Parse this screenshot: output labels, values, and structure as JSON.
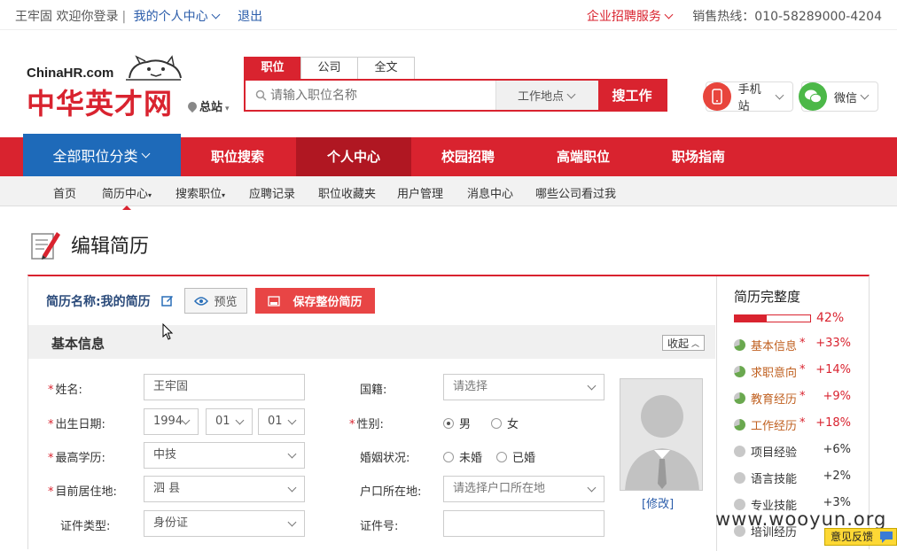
{
  "topbar": {
    "greeting": "王牢固 欢迎你登录",
    "separator": "|",
    "personal_center": "我的个人中心",
    "logout": "退出",
    "enterprise_service": "企业招聘服务",
    "hotline": "销售热线：010-58289000-4204"
  },
  "logo": {
    "en": "ChinaHR.com",
    "cn": "中华英才网"
  },
  "station": "总站",
  "search": {
    "tabs": [
      "职位",
      "公司",
      "全文"
    ],
    "placeholder": "请输入职位名称",
    "location": "工作地点",
    "button": "搜工作"
  },
  "apps": {
    "mobile": "手机站",
    "wechat": "微信"
  },
  "mainnav": {
    "all": "全部职位分类",
    "items": [
      "职位搜索",
      "个人中心",
      "校园招聘",
      "高端职位",
      "职场指南"
    ]
  },
  "subnav": [
    "首页",
    "简历中心",
    "搜索职位",
    "应聘记录",
    "职位收藏夹",
    "用户管理",
    "消息中心",
    "哪些公司看过我"
  ],
  "page_title": "编辑简历",
  "resume": {
    "name_label": "简历名称:我的简历",
    "preview": "预览",
    "save": "保存整份简历"
  },
  "section": {
    "title": "基本信息",
    "collapse": "收起"
  },
  "form": {
    "name_label": "姓名:",
    "name_value": "王牢固",
    "birth_label": "出生日期:",
    "birth_year": "1994",
    "birth_month": "01",
    "birth_day": "01",
    "edu_label": "最高学历:",
    "edu_value": "中技",
    "residence_label": "目前居住地:",
    "residence_value": "泗  县",
    "id_type_label": "证件类型:",
    "id_type_value": "身份证",
    "nationality_label": "国籍:",
    "nationality_value": "请选择",
    "gender_label": "性别:",
    "gender_male": "男",
    "gender_female": "女",
    "marital_label": "婚姻状况:",
    "marital_single": "未婚",
    "marital_married": "已婚",
    "hukou_label": "户口所在地:",
    "hukou_value": "请选择户口所在地",
    "id_no_label": "证件号:",
    "id_no_value": "",
    "photo_modify": "[修改]"
  },
  "completeness": {
    "title": "简历完整度",
    "percent": "42%",
    "fraction": 0.42,
    "items": [
      {
        "name": "基本信息",
        "star": "*",
        "value": "+33%",
        "done": true
      },
      {
        "name": "求职意向",
        "star": "*",
        "value": "+14%",
        "done": true
      },
      {
        "name": "教育经历",
        "star": "*",
        "value": "+9%",
        "done": true
      },
      {
        "name": "工作经历",
        "star": "*",
        "value": "+18%",
        "done": true
      },
      {
        "name": "项目经验",
        "star": "",
        "value": "+6%",
        "done": false
      },
      {
        "name": "语言技能",
        "star": "",
        "value": "+2%",
        "done": false
      },
      {
        "name": "专业技能",
        "star": "",
        "value": "+3%",
        "done": false
      },
      {
        "name": "培训经历",
        "star": "",
        "value": "",
        "done": false
      }
    ]
  },
  "watermark": "www.wooyun.org",
  "feedback": "意见反馈",
  "colors": {
    "brand_red": "#d9232f",
    "nav_blue": "#1e6ab9",
    "done_green": "#6aa84f"
  }
}
